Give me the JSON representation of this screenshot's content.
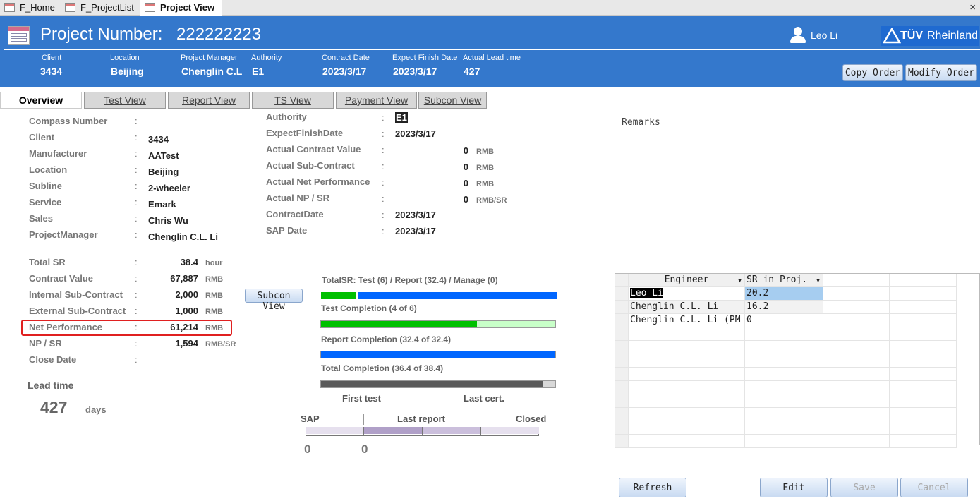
{
  "doc_tabs": [
    "F_Home",
    "F_ProjectList",
    "Project View"
  ],
  "header": {
    "title_label": "Project Number:",
    "project_number": "222222223",
    "user": "Leo Li",
    "logo": "TÜVRheinland",
    "fields": [
      {
        "label": "Client",
        "value": "3434"
      },
      {
        "label": "Location",
        "value": "Beijing"
      },
      {
        "label": "Project Manager",
        "value": "Chenglin C.L"
      },
      {
        "label": "Authority",
        "value": "E1"
      },
      {
        "label": "Contract Date",
        "value": "2023/3/17"
      },
      {
        "label": "Expect Finish Date",
        "value": "2023/3/17"
      },
      {
        "label": "Actual Lead time",
        "value": "427"
      }
    ],
    "copy_order": "Copy Order",
    "modify_order": "Modify Order"
  },
  "nav_tabs": [
    "Overview",
    "Test View",
    "Report View",
    "TS View",
    "Payment View",
    "Subcon View"
  ],
  "info_left": [
    {
      "label": "Compass Number",
      "value": ""
    },
    {
      "label": "Client",
      "value": "3434"
    },
    {
      "label": "Manufacturer",
      "value": "AATest"
    },
    {
      "label": "Location",
      "value": "Beijing"
    },
    {
      "label": "Subline",
      "value": "2-wheeler"
    },
    {
      "label": "Service",
      "value": "Emark"
    },
    {
      "label": "Sales",
      "value": "Chris Wu"
    },
    {
      "label": "ProjectManager",
      "value": "Chenglin C.L. Li"
    }
  ],
  "info_mid": [
    {
      "label": "Authority",
      "value": "E1"
    },
    {
      "label": "ExpectFinishDate",
      "value": "2023/3/17"
    },
    {
      "label": "Actual Contract Value",
      "num": "0",
      "unit": "RMB"
    },
    {
      "label": "Actual Sub-Contract",
      "num": "0",
      "unit": "RMB"
    },
    {
      "label": "Actual Net Performance",
      "num": "0",
      "unit": "RMB"
    },
    {
      "label": "Actual NP / SR",
      "num": "0",
      "unit": "RMB/SR"
    },
    {
      "label": "ContractDate",
      "value": "2023/3/17"
    },
    {
      "label": "SAP Date",
      "value": "2023/3/17"
    }
  ],
  "remarks_label": "Remarks",
  "financial": [
    {
      "label": "Total SR",
      "num": "38.4",
      "unit": "hour"
    },
    {
      "label": "Contract Value",
      "num": "67,887",
      "unit": "RMB"
    },
    {
      "label": "Internal Sub-Contract",
      "num": "2,000",
      "unit": "RMB"
    },
    {
      "label": "External Sub-Contract",
      "num": "1,000",
      "unit": "RMB"
    },
    {
      "label": "Net Performance",
      "num": "61,214",
      "unit": "RMB"
    },
    {
      "label": "NP / SR",
      "num": "1,594",
      "unit": "RMB/SR"
    },
    {
      "label": "Close Date",
      "num": "",
      "unit": ""
    }
  ],
  "lead_time": {
    "label": "Lead time",
    "value": "427",
    "unit": "days"
  },
  "subcon_view_button": "Subcon View",
  "progress": {
    "total_sr_label": "TotalSR: Test (6) / Report (32.4) / Manage (0)",
    "test_share": 0.156,
    "test_label": "Test Completion (4 of 6)",
    "test_fraction": 0.667,
    "report_label": "Report Completion (32.4 of 32.4)",
    "report_fraction": 1.0,
    "total_label": "Total Completion (36.4 of 38.4)",
    "total_fraction": 0.948
  },
  "timeline": {
    "first_test": "First test",
    "last_cert": "Last cert.",
    "sap": "SAP",
    "last_report": "Last report",
    "closed": "Closed",
    "value1": "0",
    "value2": "0"
  },
  "grid": {
    "headers": [
      "Engineer",
      "SR in Proj."
    ],
    "rows": [
      [
        "Leo Li",
        "20.2"
      ],
      [
        "Chenglin C.L. Li",
        "16.2"
      ],
      [
        "Chenglin C.L. Li (PM",
        "0"
      ]
    ]
  },
  "footer": {
    "refresh": "Refresh",
    "edit": "Edit",
    "save": "Save",
    "cancel": "Cancel"
  },
  "colors": {
    "header_blue": "#3478cc",
    "green": "#00c000",
    "blue": "#0066ff",
    "highlight": "#e02020"
  }
}
